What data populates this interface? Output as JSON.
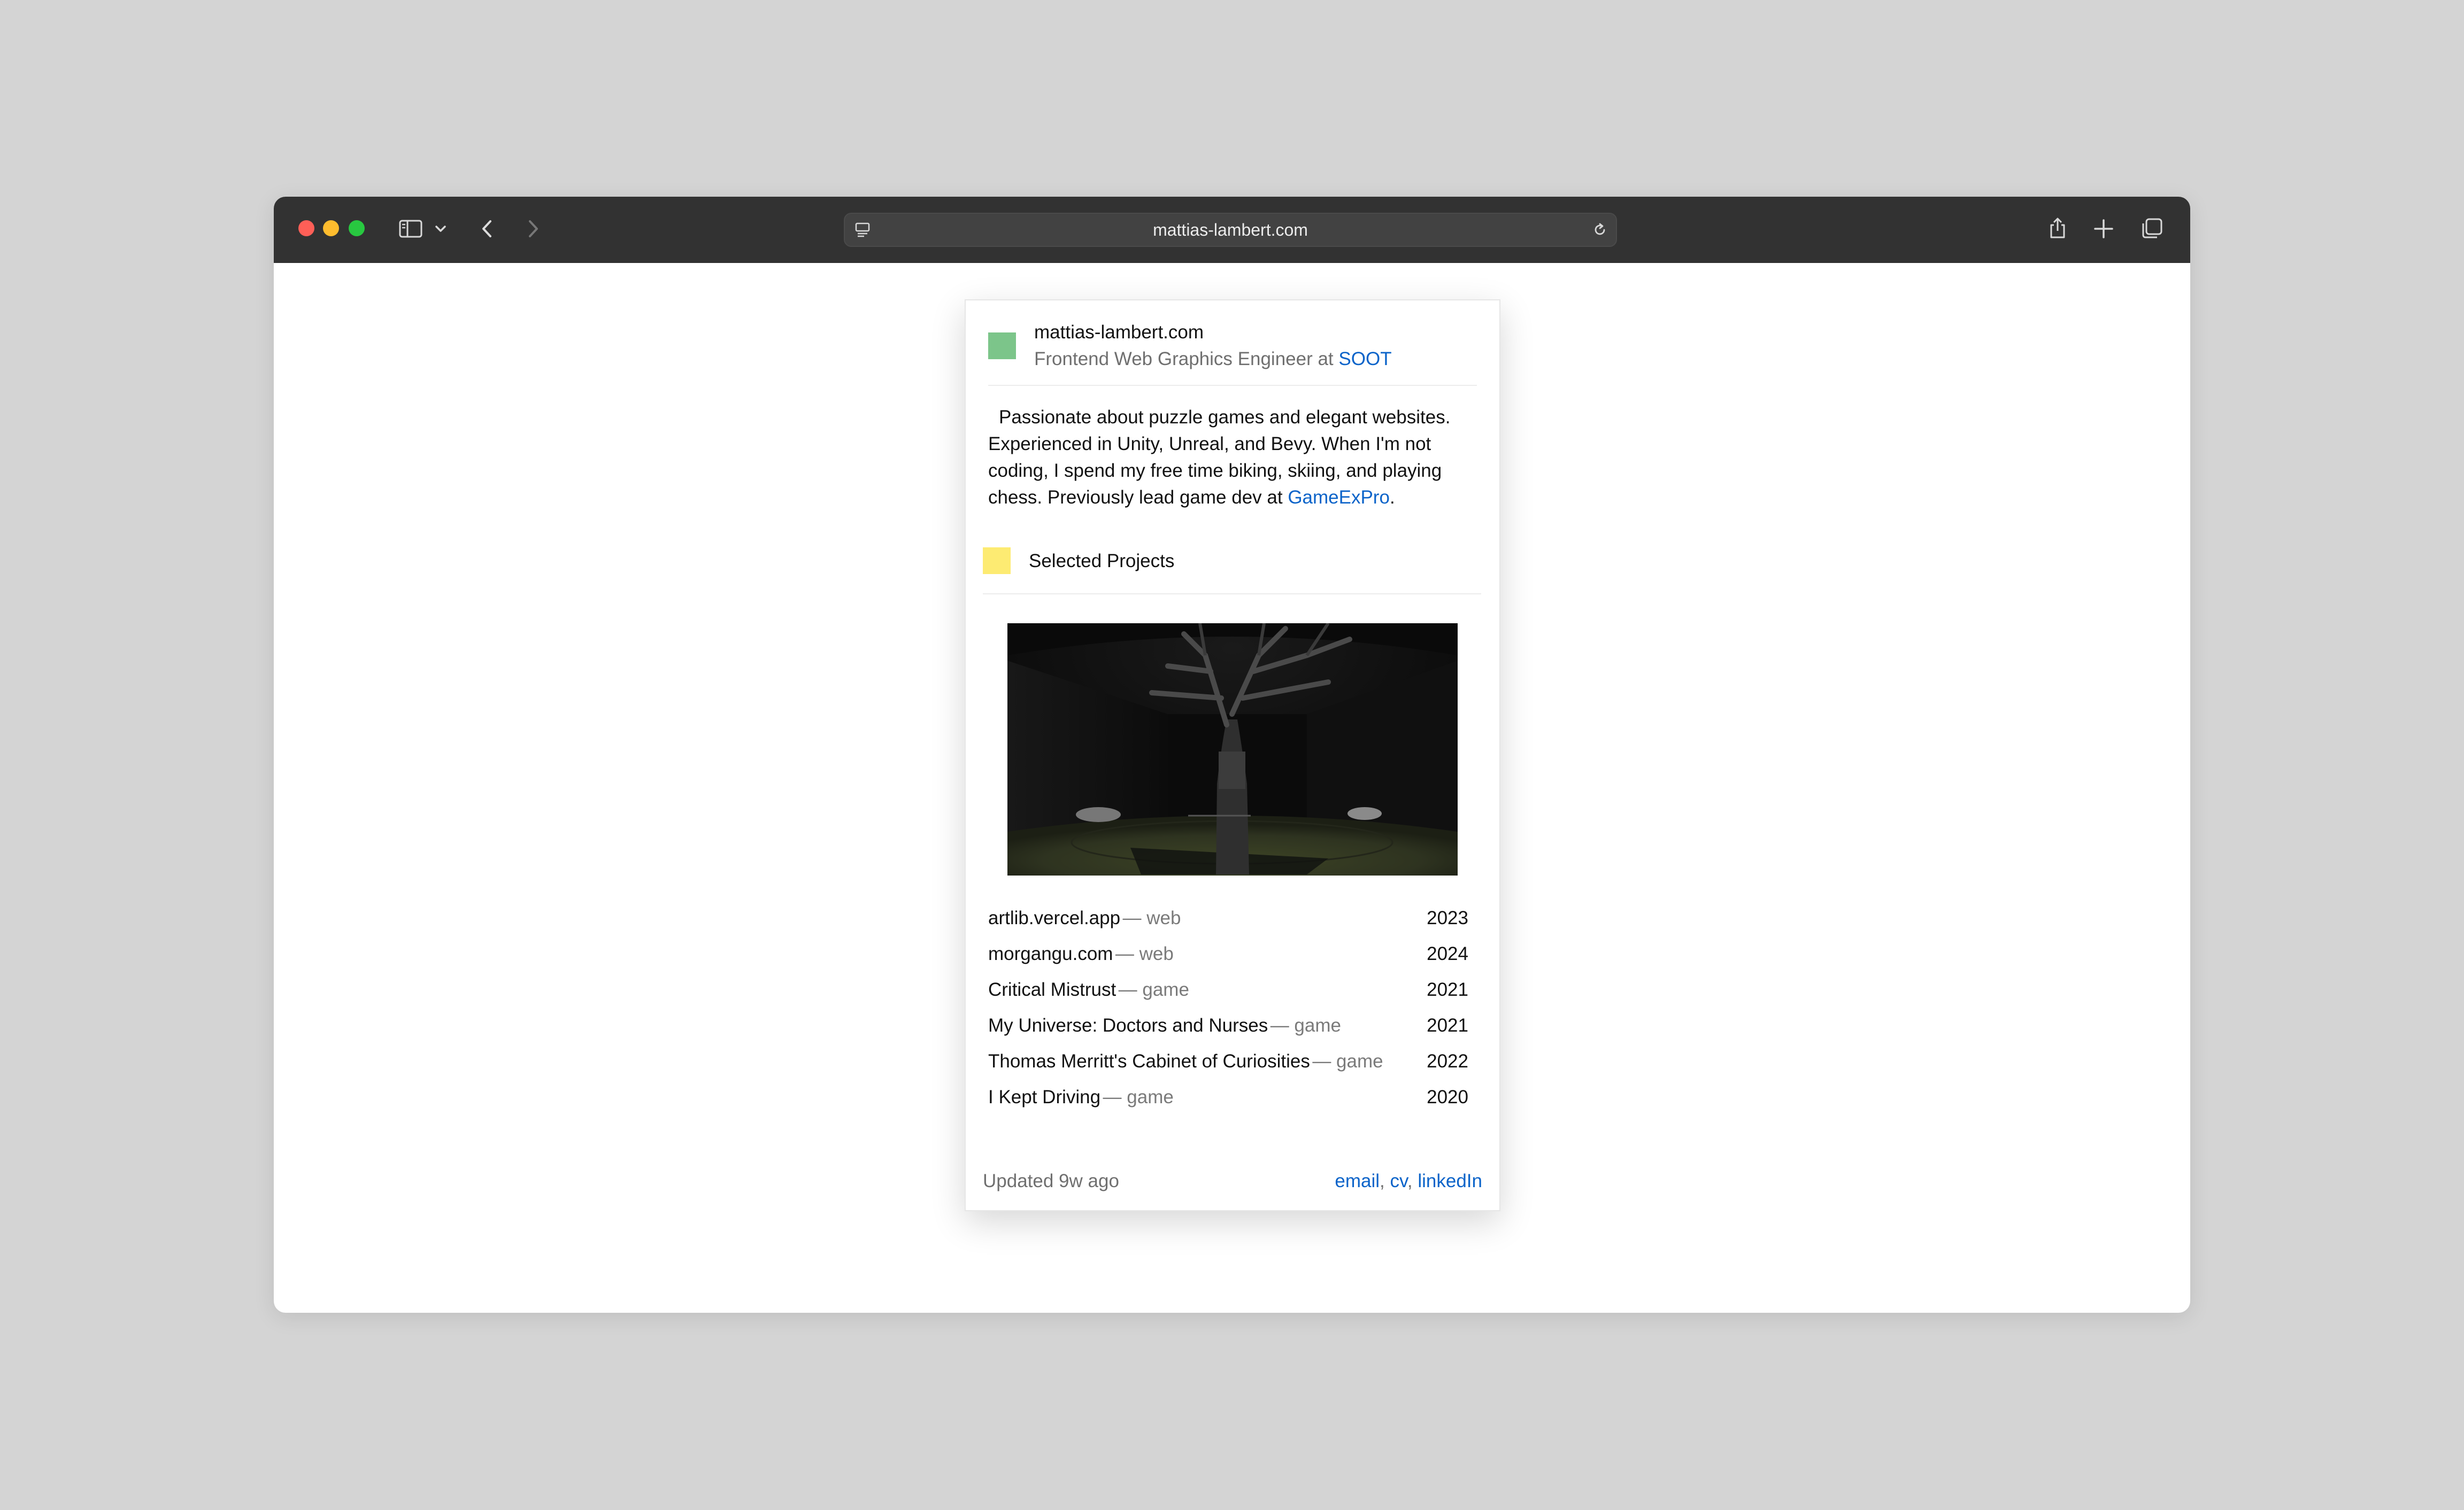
{
  "browser": {
    "url": "mattias-lambert.com"
  },
  "profile": {
    "site_name": "mattias-lambert.com",
    "role_prefix": "Frontend Web Graphics Engineer at",
    "company": "SOOT",
    "avatar_color": "#7cc58a"
  },
  "bio": {
    "line1": "Passionate about puzzle games and elegant websites.",
    "line2": "Experienced in Unity, Unreal, and Bevy. When I'm not",
    "line3": "coding, I spend my free time biking, skiing, and playing",
    "line4_prefix": "chess. Previously lead game dev at",
    "line4_link": "GameExPro",
    "line4_suffix": "."
  },
  "projects_section": {
    "title": "Selected Projects",
    "icon_color": "#fdeb72"
  },
  "projects": [
    {
      "name": "artlib.vercel.app",
      "type": "— web",
      "year": "2023"
    },
    {
      "name": "morgangu.com",
      "type": "— web",
      "year": "2024"
    },
    {
      "name": "Critical Mistrust",
      "type": "— game",
      "year": "2021"
    },
    {
      "name": "My Universe: Doctors and Nurses",
      "type": "— game",
      "year": "2021"
    },
    {
      "name": "Thomas Merritt's Cabinet of Curiosities",
      "type": "— game",
      "year": "2022"
    },
    {
      "name": "I Kept Driving",
      "type": "— game",
      "year": "2020"
    }
  ],
  "footer": {
    "updated": "Updated 9w ago",
    "links": [
      "email",
      "cv",
      "linkedIn"
    ]
  },
  "colors": {
    "link": "#0a63c9",
    "toolbar": "#323232"
  }
}
